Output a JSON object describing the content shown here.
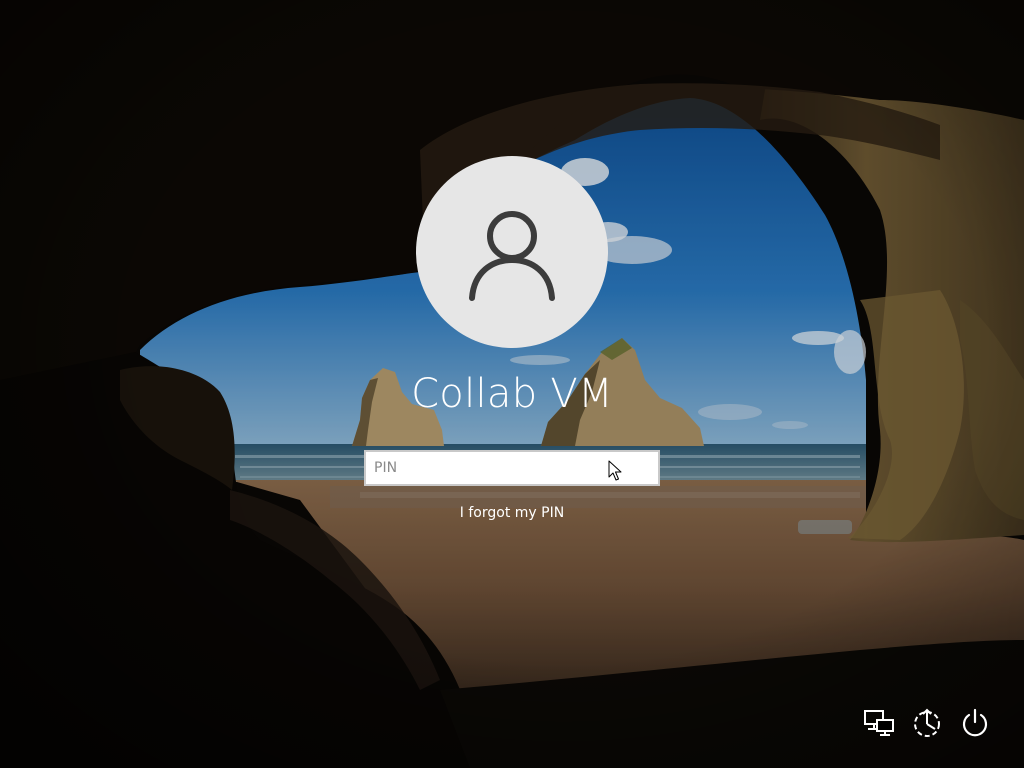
{
  "lock_screen": {
    "username": "Collab VM",
    "pin_placeholder": "PIN",
    "pin_value": "",
    "forgot_link": "I forgot my PIN"
  },
  "tray": {
    "network_icon": "network-icon",
    "ease_of_access_icon": "ease-of-access-icon",
    "power_icon": "power-icon"
  },
  "colors": {
    "avatar_bg": "#e6e6e6",
    "avatar_glyph": "#3c3c3c",
    "text": "#ffffff",
    "sky": "#1f67ad",
    "cave": "#0a0705"
  }
}
